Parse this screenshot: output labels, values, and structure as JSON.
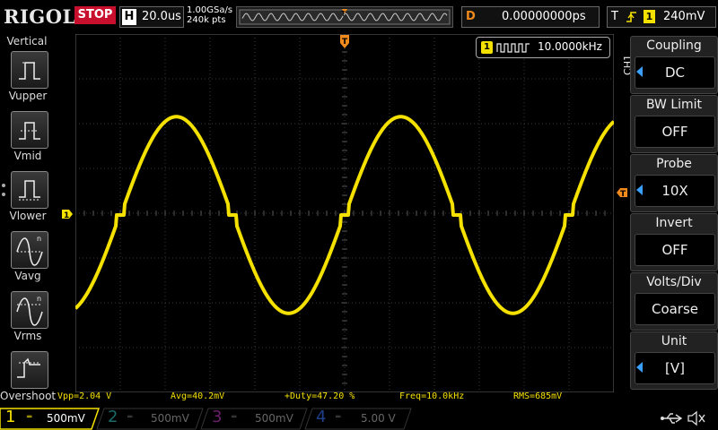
{
  "header": {
    "brand": "RIGOL",
    "run_state": "STOP",
    "horiz_label": "H",
    "timebase": "20.0us",
    "sample_rate": "1.00GSa/s",
    "memory_depth": "240k pts",
    "delay_label": "D",
    "delay_value": "0.00000000ps",
    "trigger_label": "T",
    "trigger_channel": "1",
    "trigger_level": "240mV"
  },
  "left_panel": {
    "title": "Vertical",
    "items": [
      {
        "label": "Vupper",
        "icon": "pulse-upper-icon"
      },
      {
        "label": "Vmid",
        "icon": "pulse-mid-icon"
      },
      {
        "label": "Vlower",
        "icon": "pulse-lower-icon"
      },
      {
        "label": "Vavg",
        "icon": "sine-avg-icon"
      },
      {
        "label": "Vrms",
        "icon": "sine-rms-icon"
      },
      {
        "label": "Overshoot",
        "icon": "overshoot-icon"
      }
    ]
  },
  "freq_counter": {
    "channel": "1",
    "value": "10.0000kHz"
  },
  "channel_tag": "CH1",
  "right_panel": {
    "items": [
      {
        "header": "Coupling",
        "value": "DC"
      },
      {
        "header": "BW Limit",
        "value": "OFF"
      },
      {
        "header": "Probe",
        "value": "10X"
      },
      {
        "header": "Invert",
        "value": "OFF"
      },
      {
        "header": "Volts/Div",
        "value": "Coarse"
      },
      {
        "header": "Unit",
        "value": "[V]"
      }
    ]
  },
  "measurements": {
    "vpp": "Vpp=2.04 V",
    "avg": "Avg=40.2mV",
    "duty": "+Duty=47.20 %",
    "freq": "Freq=10.0kHz",
    "rms": "RMS=685mV"
  },
  "channels": [
    {
      "num": "1",
      "scale": "500mV",
      "color": "#f5e100"
    },
    {
      "num": "2",
      "scale": "500mV",
      "color": "#00c0c0"
    },
    {
      "num": "3",
      "scale": "500mV",
      "color": "#d040d0"
    },
    {
      "num": "4",
      "scale": "5.00 V",
      "color": "#2070ff"
    }
  ],
  "colors": {
    "ch1": "#f5e100",
    "trigger": "#f08a1c",
    "stop": "#c8102e",
    "grid": "#555555"
  }
}
